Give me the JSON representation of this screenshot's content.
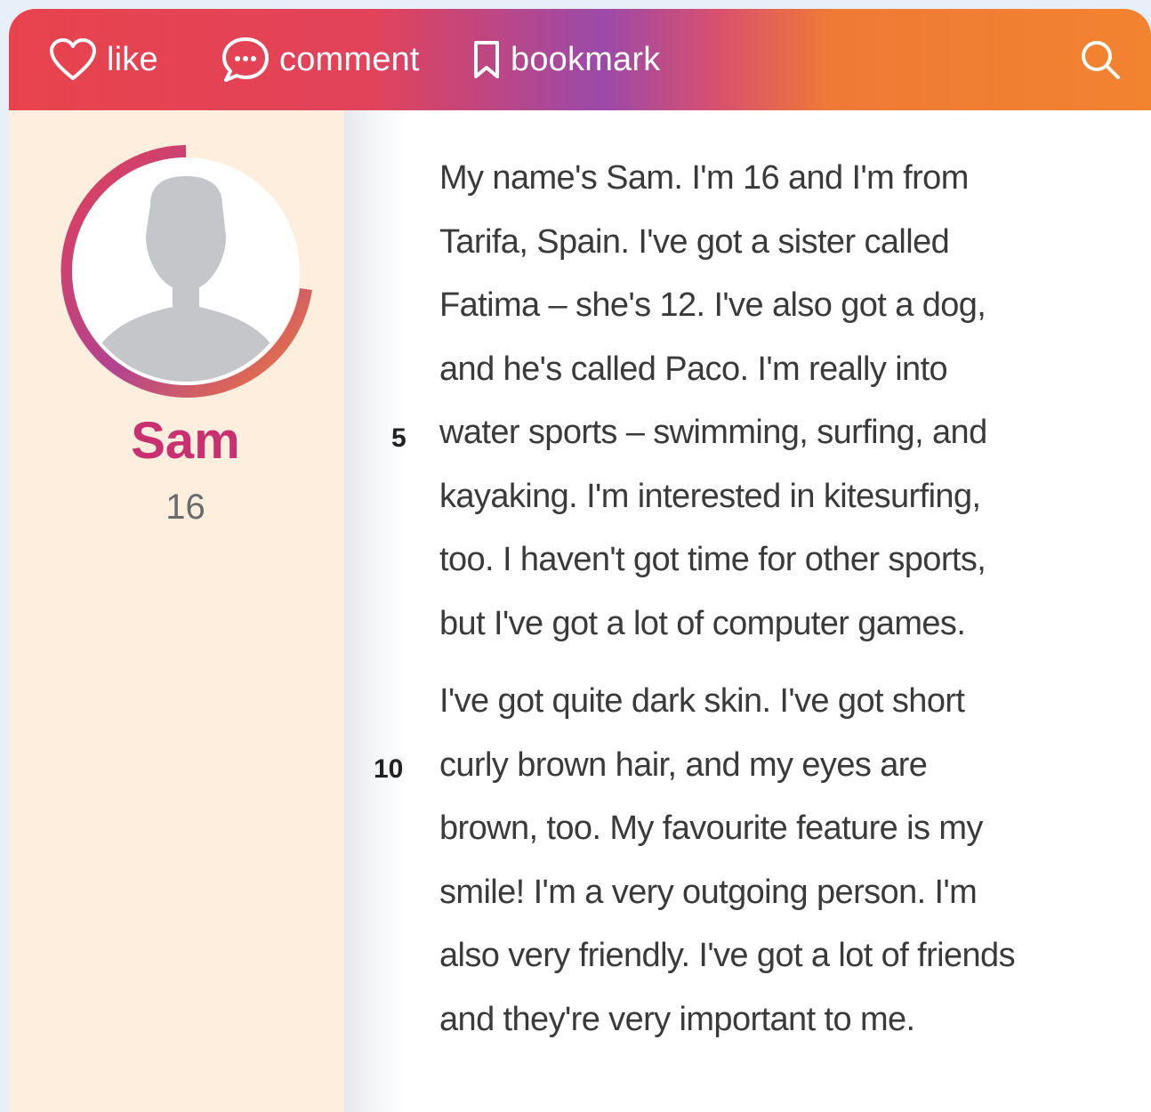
{
  "toolbar": {
    "like_label": "like",
    "comment_label": "comment",
    "bookmark_label": "bookmark",
    "icons": {
      "like": "heart-icon",
      "comment": "speech-bubble-icon",
      "bookmark": "bookmark-icon",
      "search": "search-icon"
    }
  },
  "profile": {
    "name": "Sam",
    "age": "16",
    "avatar_icon": "person-silhouette-icon"
  },
  "post": {
    "paragraph1": [
      "My name's Sam. I'm 16 and I'm from",
      "Tarifa, Spain. I've got a sister called",
      "Fatima – she's 12. I've also got a dog,",
      "and he's called Paco. I'm really into",
      "water sports – swimming, surfing, and",
      "kayaking. I'm interested in kitesurfing,",
      "too. I haven't got time for other sports,",
      "but I've got a lot of computer games."
    ],
    "paragraph2": [
      "I've got quite dark skin. I've got short",
      "curly brown hair, and my eyes are",
      "brown, too. My favourite feature is my",
      "smile! I'm a very outgoing person. I'm",
      "also very friendly. I've got a lot of friends",
      "and they're very important to me."
    ],
    "line_numbers": {
      "five": "5",
      "ten": "10"
    }
  },
  "colors": {
    "bar_start": "#e8434d",
    "bar_mid": "#9b4aa9",
    "bar_end": "#f2832f",
    "sidebar_bg": "#fdeedd",
    "name_color": "#c9306f"
  }
}
